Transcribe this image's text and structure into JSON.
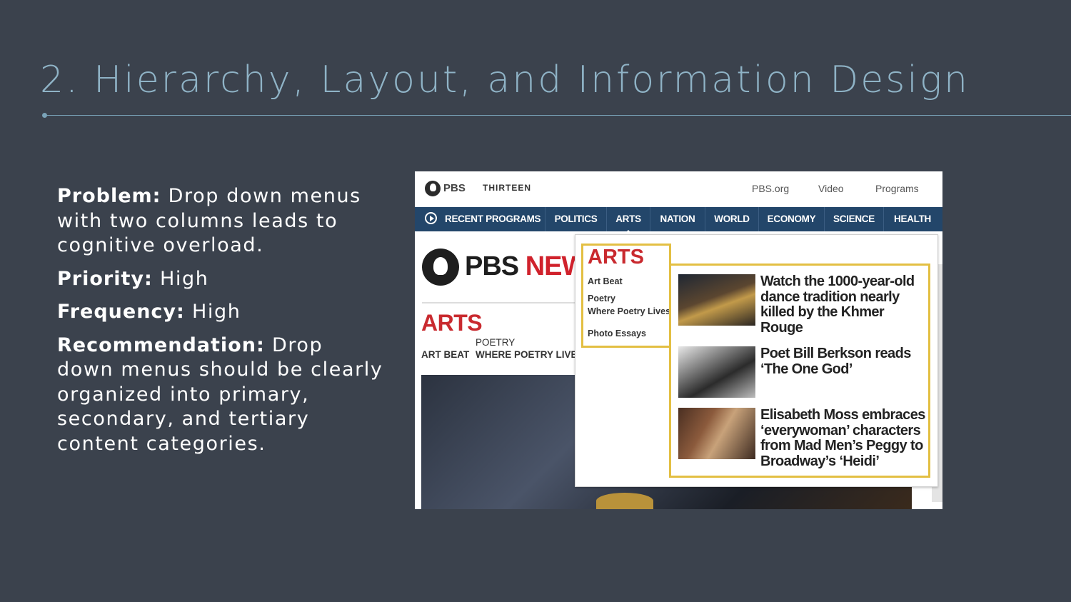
{
  "slide": {
    "title": "2. Hierarchy, Layout, and Information Design",
    "problem_label": "Problem:",
    "problem_text": "Drop down menus with two columns leads to cognitive overload.",
    "priority_label": "Priority:",
    "priority_text": "High",
    "frequency_label": "Frequency:",
    "frequency_text": "High",
    "recommendation_label": "Recommendation:",
    "recommendation_text": "Drop down menus should be clearly organized into primary, secondary, and tertiary content categories."
  },
  "screenshot": {
    "topbar": {
      "pbs_logo": "PBS",
      "station": "THIRTEEN",
      "links": [
        "PBS.org",
        "Video",
        "Programs"
      ]
    },
    "nav": [
      "RECENT PROGRAMS",
      "POLITICS",
      "ARTS",
      "NATION",
      "WORLD",
      "ECONOMY",
      "SCIENCE",
      "HEALTH"
    ],
    "page": {
      "logo_pbs": "PBS",
      "logo_news": "NEW",
      "section_title": "ARTS",
      "sub_art_beat": "ART BEAT",
      "sub_poetry": "POETRY",
      "sub_where_poetry": "WHERE POETRY LIVES"
    },
    "dropdown": {
      "heading": "ARTS",
      "links": [
        "Art Beat",
        "Poetry",
        "Where Poetry Lives",
        "Photo Essays"
      ],
      "stories": [
        {
          "title": "Watch the 1000-year-old dance tradition nearly killed by the Khmer Rouge"
        },
        {
          "title": "Poet Bill Berkson reads ‘The One God’"
        },
        {
          "title": "Elisabeth Moss embraces ‘everywoman’ characters from Mad Men’s Peggy to Broadway’s ‘Heidi’"
        }
      ]
    },
    "colors": {
      "nav_bg": "#23466a",
      "highlight": "#e3bf43",
      "accent_red": "#c92a2f"
    }
  }
}
